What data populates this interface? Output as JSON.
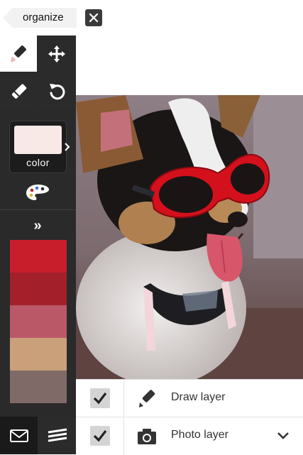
{
  "header": {
    "organize_label": "organize"
  },
  "sidebar": {
    "tools": [
      {
        "name": "brush-tool",
        "icon": "brush-icon",
        "selected": true
      },
      {
        "name": "move-tool",
        "icon": "move-arrows-icon",
        "selected": false
      },
      {
        "name": "eraser-tool",
        "icon": "eraser-icon",
        "selected": false
      },
      {
        "name": "undo-tool",
        "icon": "undo-icon",
        "selected": false
      }
    ],
    "color_label": "color",
    "current_color": "#f8e8e6",
    "expand_label": "»",
    "swatches": [
      "#c81e2c",
      "#a3202a",
      "#bb5868",
      "#c9a07a",
      "#806a68"
    ]
  },
  "layers": {
    "items": [
      {
        "name": "Draw layer",
        "icon": "brush-icon",
        "checked": true
      },
      {
        "name": "Photo layer",
        "icon": "camera-icon",
        "checked": true
      }
    ]
  },
  "colors": {
    "sidebar_bg": "#2a2a2a",
    "accent_red": "#c81e2c"
  }
}
